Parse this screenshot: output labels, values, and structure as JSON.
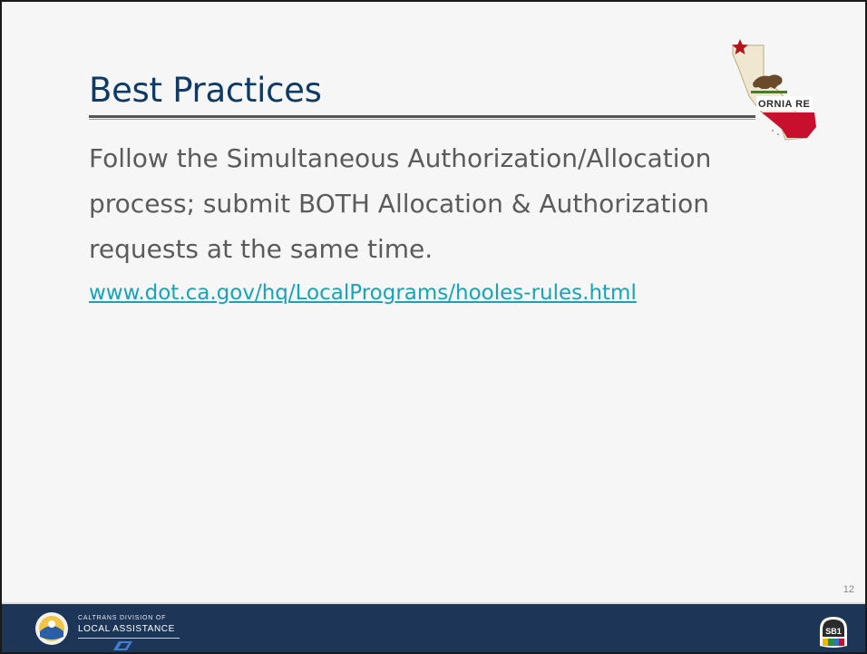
{
  "slide": {
    "title": "Best Practices",
    "body": "Follow the Simultaneous Authorization/Allocation process; submit BOTH Allocation & Authorization requests at the same time.",
    "link": "www.dot.ca.gov/hq/LocalPrograms/hooles-rules.html",
    "page_number": "12",
    "flag_text": "ORNIA RE"
  },
  "footer": {
    "org_line1": "CALTRANS DIVISION OF",
    "org_line2": "LOCAL ASSISTANCE",
    "sb1_badge": "SB1"
  },
  "colors": {
    "title": "#0e3a66",
    "link": "#17a3b8",
    "footer_bg": "#1d3557",
    "flag_red": "#c8102e",
    "star_red": "#b5121b"
  },
  "icons": [
    "california-flag-map-logo",
    "caltrans-seal-icon",
    "caltrans-logo-icon",
    "sb1-badge-icon"
  ]
}
